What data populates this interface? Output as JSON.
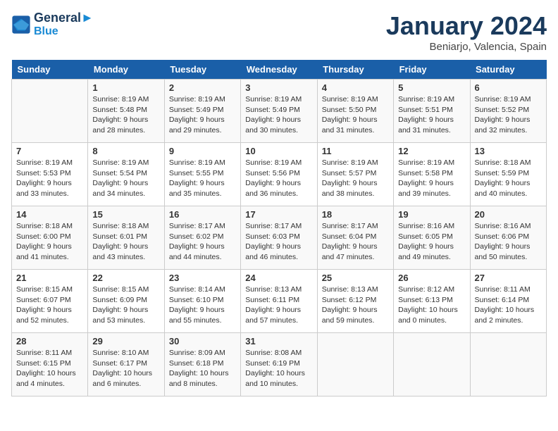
{
  "logo": {
    "line1": "General",
    "line2": "Blue"
  },
  "title": "January 2024",
  "subtitle": "Beniarjo, Valencia, Spain",
  "days_header": [
    "Sunday",
    "Monday",
    "Tuesday",
    "Wednesday",
    "Thursday",
    "Friday",
    "Saturday"
  ],
  "weeks": [
    [
      {
        "day": "",
        "text": ""
      },
      {
        "day": "1",
        "text": "Sunrise: 8:19 AM\nSunset: 5:48 PM\nDaylight: 9 hours\nand 28 minutes."
      },
      {
        "day": "2",
        "text": "Sunrise: 8:19 AM\nSunset: 5:49 PM\nDaylight: 9 hours\nand 29 minutes."
      },
      {
        "day": "3",
        "text": "Sunrise: 8:19 AM\nSunset: 5:49 PM\nDaylight: 9 hours\nand 30 minutes."
      },
      {
        "day": "4",
        "text": "Sunrise: 8:19 AM\nSunset: 5:50 PM\nDaylight: 9 hours\nand 31 minutes."
      },
      {
        "day": "5",
        "text": "Sunrise: 8:19 AM\nSunset: 5:51 PM\nDaylight: 9 hours\nand 31 minutes."
      },
      {
        "day": "6",
        "text": "Sunrise: 8:19 AM\nSunset: 5:52 PM\nDaylight: 9 hours\nand 32 minutes."
      }
    ],
    [
      {
        "day": "7",
        "text": "Sunrise: 8:19 AM\nSunset: 5:53 PM\nDaylight: 9 hours\nand 33 minutes."
      },
      {
        "day": "8",
        "text": "Sunrise: 8:19 AM\nSunset: 5:54 PM\nDaylight: 9 hours\nand 34 minutes."
      },
      {
        "day": "9",
        "text": "Sunrise: 8:19 AM\nSunset: 5:55 PM\nDaylight: 9 hours\nand 35 minutes."
      },
      {
        "day": "10",
        "text": "Sunrise: 8:19 AM\nSunset: 5:56 PM\nDaylight: 9 hours\nand 36 minutes."
      },
      {
        "day": "11",
        "text": "Sunrise: 8:19 AM\nSunset: 5:57 PM\nDaylight: 9 hours\nand 38 minutes."
      },
      {
        "day": "12",
        "text": "Sunrise: 8:19 AM\nSunset: 5:58 PM\nDaylight: 9 hours\nand 39 minutes."
      },
      {
        "day": "13",
        "text": "Sunrise: 8:18 AM\nSunset: 5:59 PM\nDaylight: 9 hours\nand 40 minutes."
      }
    ],
    [
      {
        "day": "14",
        "text": "Sunrise: 8:18 AM\nSunset: 6:00 PM\nDaylight: 9 hours\nand 41 minutes."
      },
      {
        "day": "15",
        "text": "Sunrise: 8:18 AM\nSunset: 6:01 PM\nDaylight: 9 hours\nand 43 minutes."
      },
      {
        "day": "16",
        "text": "Sunrise: 8:17 AM\nSunset: 6:02 PM\nDaylight: 9 hours\nand 44 minutes."
      },
      {
        "day": "17",
        "text": "Sunrise: 8:17 AM\nSunset: 6:03 PM\nDaylight: 9 hours\nand 46 minutes."
      },
      {
        "day": "18",
        "text": "Sunrise: 8:17 AM\nSunset: 6:04 PM\nDaylight: 9 hours\nand 47 minutes."
      },
      {
        "day": "19",
        "text": "Sunrise: 8:16 AM\nSunset: 6:05 PM\nDaylight: 9 hours\nand 49 minutes."
      },
      {
        "day": "20",
        "text": "Sunrise: 8:16 AM\nSunset: 6:06 PM\nDaylight: 9 hours\nand 50 minutes."
      }
    ],
    [
      {
        "day": "21",
        "text": "Sunrise: 8:15 AM\nSunset: 6:07 PM\nDaylight: 9 hours\nand 52 minutes."
      },
      {
        "day": "22",
        "text": "Sunrise: 8:15 AM\nSunset: 6:09 PM\nDaylight: 9 hours\nand 53 minutes."
      },
      {
        "day": "23",
        "text": "Sunrise: 8:14 AM\nSunset: 6:10 PM\nDaylight: 9 hours\nand 55 minutes."
      },
      {
        "day": "24",
        "text": "Sunrise: 8:13 AM\nSunset: 6:11 PM\nDaylight: 9 hours\nand 57 minutes."
      },
      {
        "day": "25",
        "text": "Sunrise: 8:13 AM\nSunset: 6:12 PM\nDaylight: 9 hours\nand 59 minutes."
      },
      {
        "day": "26",
        "text": "Sunrise: 8:12 AM\nSunset: 6:13 PM\nDaylight: 10 hours\nand 0 minutes."
      },
      {
        "day": "27",
        "text": "Sunrise: 8:11 AM\nSunset: 6:14 PM\nDaylight: 10 hours\nand 2 minutes."
      }
    ],
    [
      {
        "day": "28",
        "text": "Sunrise: 8:11 AM\nSunset: 6:15 PM\nDaylight: 10 hours\nand 4 minutes."
      },
      {
        "day": "29",
        "text": "Sunrise: 8:10 AM\nSunset: 6:17 PM\nDaylight: 10 hours\nand 6 minutes."
      },
      {
        "day": "30",
        "text": "Sunrise: 8:09 AM\nSunset: 6:18 PM\nDaylight: 10 hours\nand 8 minutes."
      },
      {
        "day": "31",
        "text": "Sunrise: 8:08 AM\nSunset: 6:19 PM\nDaylight: 10 hours\nand 10 minutes."
      },
      {
        "day": "",
        "text": ""
      },
      {
        "day": "",
        "text": ""
      },
      {
        "day": "",
        "text": ""
      }
    ]
  ]
}
